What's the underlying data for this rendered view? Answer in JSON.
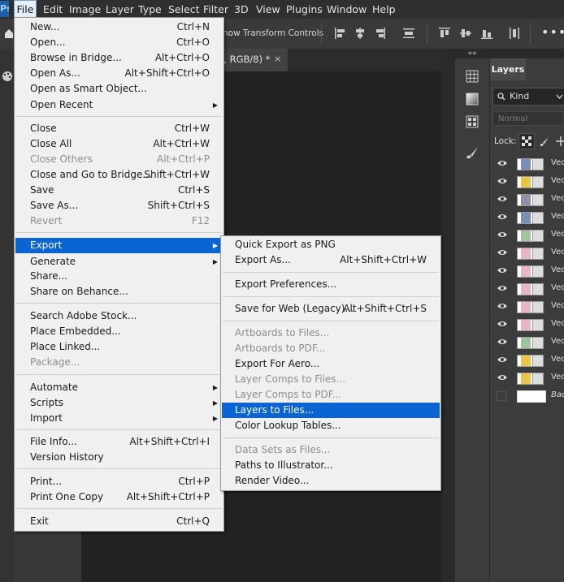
{
  "menubar": {
    "app_tab": "Ps",
    "items": [
      "File",
      "Edit",
      "Image",
      "Layer",
      "Type",
      "Select",
      "Filter",
      "3D",
      "View",
      "Plugins",
      "Window",
      "Help"
    ]
  },
  "options_bar": {
    "show_transform": "how Transform Controls",
    "more": "•••"
  },
  "document": {
    "tab_title": "d, RGB/8) *",
    "close": "×"
  },
  "layers_panel": {
    "collapse": "««",
    "tab": "Layers",
    "filter": "Kind",
    "blend_mode": "Normal",
    "lock_label": "Lock:",
    "layers": [
      {
        "name": "Vec",
        "visible": true
      },
      {
        "name": "Vec",
        "visible": true
      },
      {
        "name": "Vec",
        "visible": true
      },
      {
        "name": "Vec",
        "visible": true
      },
      {
        "name": "Vec",
        "visible": true
      },
      {
        "name": "Vec",
        "visible": true
      },
      {
        "name": "Vec",
        "visible": true
      },
      {
        "name": "Vec",
        "visible": true
      },
      {
        "name": "Vec",
        "visible": true
      },
      {
        "name": "Vec",
        "visible": true
      },
      {
        "name": "Vec",
        "visible": true
      },
      {
        "name": "Vec",
        "visible": true
      },
      {
        "name": "Vec",
        "visible": true
      },
      {
        "name": "Bac",
        "visible": false
      }
    ]
  },
  "file_menu": {
    "items": [
      {
        "label": "New...",
        "shortcut": "Ctrl+N"
      },
      {
        "label": "Open...",
        "shortcut": "Ctrl+O"
      },
      {
        "label": "Browse in Bridge...",
        "shortcut": "Alt+Ctrl+O"
      },
      {
        "label": "Open As...",
        "shortcut": "Alt+Shift+Ctrl+O"
      },
      {
        "label": "Open as Smart Object..."
      },
      {
        "label": "Open Recent",
        "submenu": true
      },
      {
        "label": "Close",
        "shortcut": "Ctrl+W"
      },
      {
        "label": "Close All",
        "shortcut": "Alt+Ctrl+W"
      },
      {
        "label": "Close Others",
        "shortcut": "Alt+Ctrl+P",
        "disabled": true
      },
      {
        "label": "Close and Go to Bridge...",
        "shortcut": "Shift+Ctrl+W"
      },
      {
        "label": "Save",
        "shortcut": "Ctrl+S"
      },
      {
        "label": "Save As...",
        "shortcut": "Shift+Ctrl+S"
      },
      {
        "label": "Revert",
        "shortcut": "F12",
        "disabled": true
      },
      {
        "label": "Export",
        "submenu": true,
        "highlight": true
      },
      {
        "label": "Generate",
        "submenu": true
      },
      {
        "label": "Share..."
      },
      {
        "label": "Share on Behance..."
      },
      {
        "label": "Search Adobe Stock..."
      },
      {
        "label": "Place Embedded..."
      },
      {
        "label": "Place Linked..."
      },
      {
        "label": "Package...",
        "disabled": true
      },
      {
        "label": "Automate",
        "submenu": true
      },
      {
        "label": "Scripts",
        "submenu": true
      },
      {
        "label": "Import",
        "submenu": true
      },
      {
        "label": "File Info...",
        "shortcut": "Alt+Shift+Ctrl+I"
      },
      {
        "label": "Version History"
      },
      {
        "label": "Print...",
        "shortcut": "Ctrl+P"
      },
      {
        "label": "Print One Copy",
        "shortcut": "Alt+Shift+Ctrl+P"
      },
      {
        "label": "Exit",
        "shortcut": "Ctrl+Q"
      }
    ]
  },
  "export_menu": {
    "items": [
      {
        "label": "Quick Export as PNG"
      },
      {
        "label": "Export As...",
        "shortcut": "Alt+Shift+Ctrl+W"
      },
      {
        "label": "Export Preferences..."
      },
      {
        "label": "Save for Web (Legacy)...",
        "shortcut": "Alt+Shift+Ctrl+S"
      },
      {
        "label": "Artboards to Files...",
        "disabled": true
      },
      {
        "label": "Artboards to PDF...",
        "disabled": true
      },
      {
        "label": "Export For Aero..."
      },
      {
        "label": "Layer Comps to Files...",
        "disabled": true
      },
      {
        "label": "Layer Comps to PDF...",
        "disabled": true
      },
      {
        "label": "Layers to Files...",
        "highlight": true
      },
      {
        "label": "Color Lookup Tables..."
      },
      {
        "label": "Data Sets as Files...",
        "disabled": true
      },
      {
        "label": "Paths to Illustrator..."
      },
      {
        "label": "Render Video..."
      }
    ]
  },
  "colors": {
    "highlight": "#0a64d2",
    "menu_bg": "#f0f0f0",
    "ui_dark": "#3c3c3c"
  }
}
